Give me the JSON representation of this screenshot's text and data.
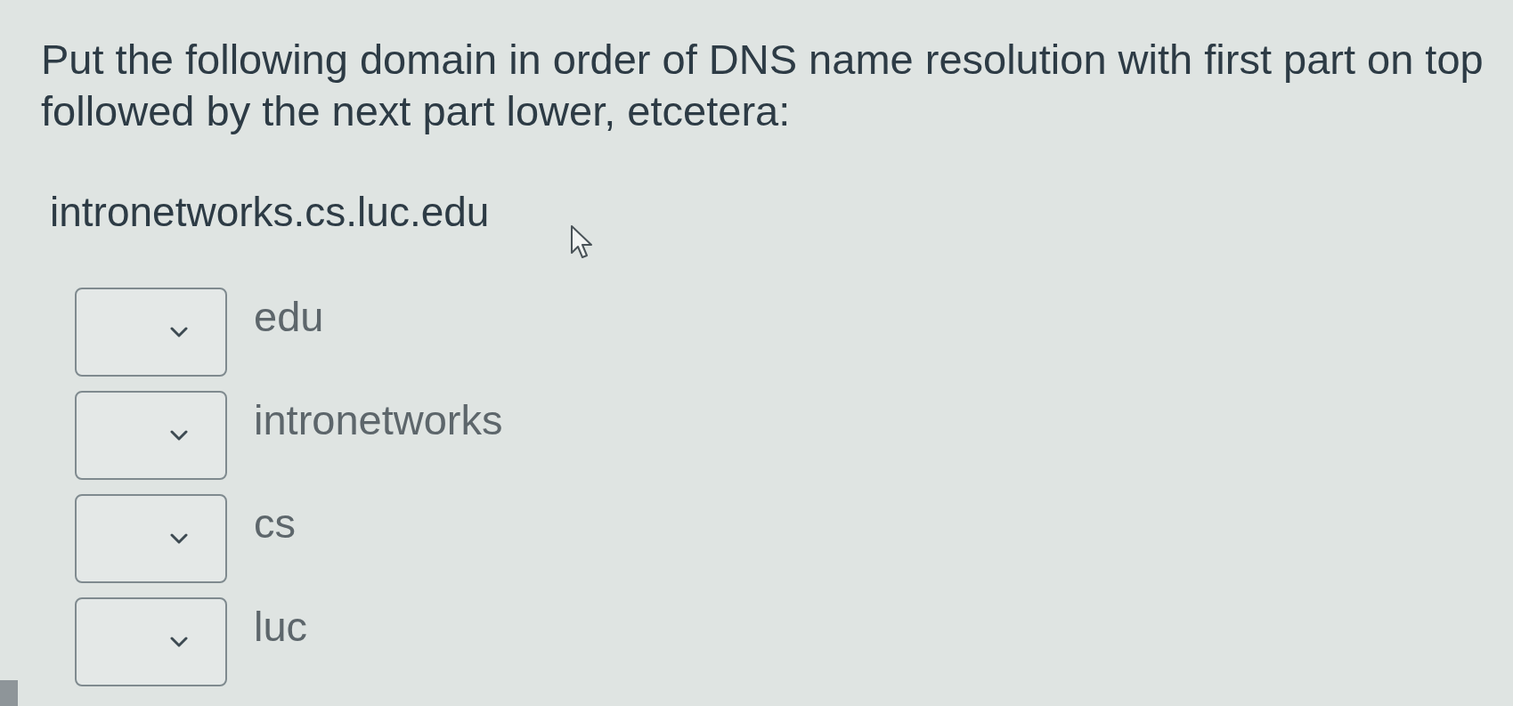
{
  "question": {
    "lines": [
      "Put the following domain in order of DNS name resolution with first part on top",
      "followed by the next part lower, etcetera:"
    ]
  },
  "domain": "intronetworks.cs.luc.edu",
  "answers": [
    {
      "label": "edu"
    },
    {
      "label": "intronetworks"
    },
    {
      "label": "cs"
    },
    {
      "label": "luc"
    }
  ]
}
